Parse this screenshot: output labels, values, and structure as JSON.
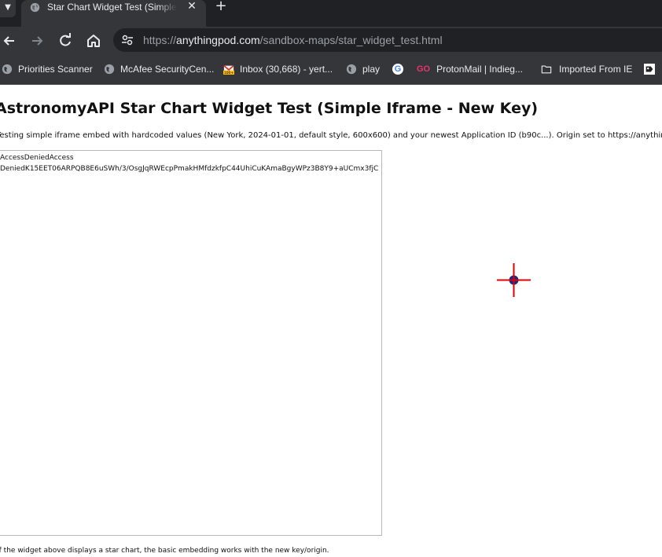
{
  "browser": {
    "tab": {
      "title": "Star Chart Widget Test (Simple Iframe - New Key)",
      "close_icon": "close-icon",
      "favicon": "globe-icon"
    },
    "new_tab_icon": "plus-icon",
    "tab_search_icon": "chevron-down-icon",
    "toolbar": {
      "back_icon": "arrow-left-icon",
      "forward_icon": "arrow-right-icon",
      "reload_icon": "reload-icon",
      "home_icon": "home-icon",
      "site_info_icon": "tune-icon"
    },
    "url": {
      "scheme": "https://",
      "host": "anythingpod.com",
      "path": "/sandbox-maps/star_widget_test.html"
    },
    "bookmarks": [
      {
        "label": "Priorities Scanner",
        "icon": "globe-icon"
      },
      {
        "label": "McAfee SecurityCen...",
        "icon": "globe-icon"
      },
      {
        "label": "Inbox (30,668) - yert...",
        "icon": "mail-icon"
      },
      {
        "label": "play",
        "icon": "globe-icon"
      },
      {
        "label": "",
        "icon": "google-icon"
      },
      {
        "label": "ProtonMail | Indieg...",
        "icon": "go-icon"
      },
      {
        "label": "Imported From IE",
        "icon": "folder-icon"
      },
      {
        "label": "",
        "icon": "bookmark-icon"
      }
    ]
  },
  "page": {
    "title": "AstronomyAPI Star Chart Widget Test (Simple Iframe - New Key)",
    "description": "Testing simple iframe embed with hardcoded values (New York, 2024-01-01, default style, 600x600) and your newest Application ID (b90c...). Origin set to https://anythingpod.com/",
    "iframe_error_line1": "AccessDeniedAccess",
    "iframe_error_line2": "DeniedK15EET06ARPQB8E6uSWh/3/OsgJqRWEcpPmakHMfdzkfpC44UhiCuKAmaBgyWPz3B8Y9+aUCmx3fjC",
    "note": "If the widget above displays a star chart, the basic embedding works with the new key/origin."
  },
  "colors": {
    "tab_bg": "#202124",
    "toolbar_bg": "#35363a",
    "text_light": "#e8eaed",
    "cursor_red": "#e00000",
    "cursor_blue": "#1a2a8a"
  }
}
